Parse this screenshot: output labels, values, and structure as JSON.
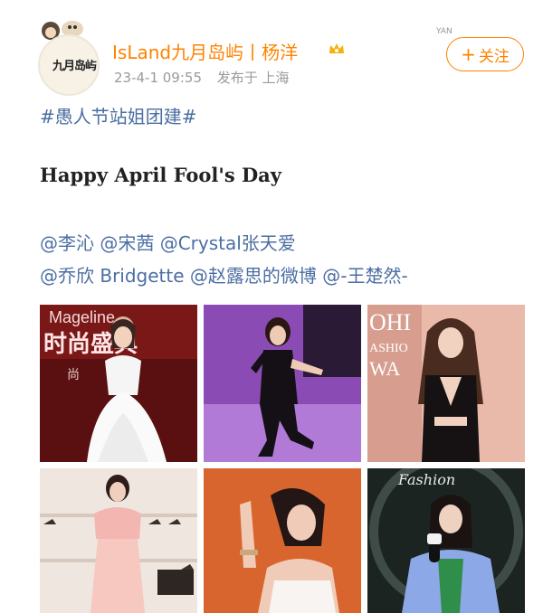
{
  "post": {
    "avatar_text": "九月岛屿",
    "username": "IsLand九月岛屿丨杨洋",
    "timestamp": "23-4-1 09:55",
    "location": "发布于 上海",
    "follow_label": "关注",
    "topic": "#愚人节站姐团建#",
    "headline": "Happy April Fool's Day",
    "mentions_line1": "@李沁 @宋茜 @Crystal张天爱",
    "mentions_line2": "@乔欣 Bridgette @赵露思的微博 @-王楚然-",
    "peek_label": "YAN"
  },
  "photos": [
    {
      "caption_lines": [
        "Mageline",
        "时尚盛典",
        "尚"
      ]
    },
    {
      "caption_lines": []
    },
    {
      "caption_lines": [
        "OHI",
        "ASHIO",
        "WA"
      ]
    },
    {
      "caption_lines": []
    },
    {
      "caption_lines": []
    },
    {
      "caption_lines": [
        "Fashion"
      ]
    }
  ],
  "colors": {
    "accent": "#ff8200",
    "link": "#4b6ea3",
    "meta": "#9a9a9a"
  },
  "icons": [
    "crown-icon",
    "plus-icon",
    "avatar-icon"
  ]
}
